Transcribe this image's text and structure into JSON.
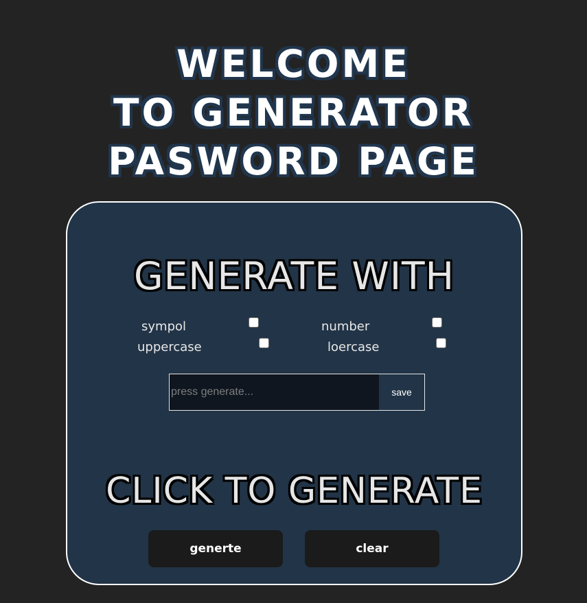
{
  "header": {
    "lines": [
      "WELCOME",
      "TO GENERATOR",
      "PASWORD PAGE"
    ]
  },
  "card": {
    "options_heading": "GENERATE WITH",
    "options": [
      {
        "label": "sympol",
        "checked": false
      },
      {
        "label": "number",
        "checked": false
      },
      {
        "label": "uppercase",
        "checked": false
      },
      {
        "label": "loercase",
        "checked": false
      }
    ],
    "output": {
      "value": "",
      "placeholder": "press generate...",
      "save_label": "save"
    },
    "action_heading": "CLICK TO GENERATE",
    "buttons": {
      "generate_label": "generte",
      "clear_label": "clear"
    }
  },
  "colors": {
    "page_background": "#232323",
    "card_background": "#223447",
    "heading_outline": "#21364d",
    "button_background": "#1b1b1b"
  }
}
